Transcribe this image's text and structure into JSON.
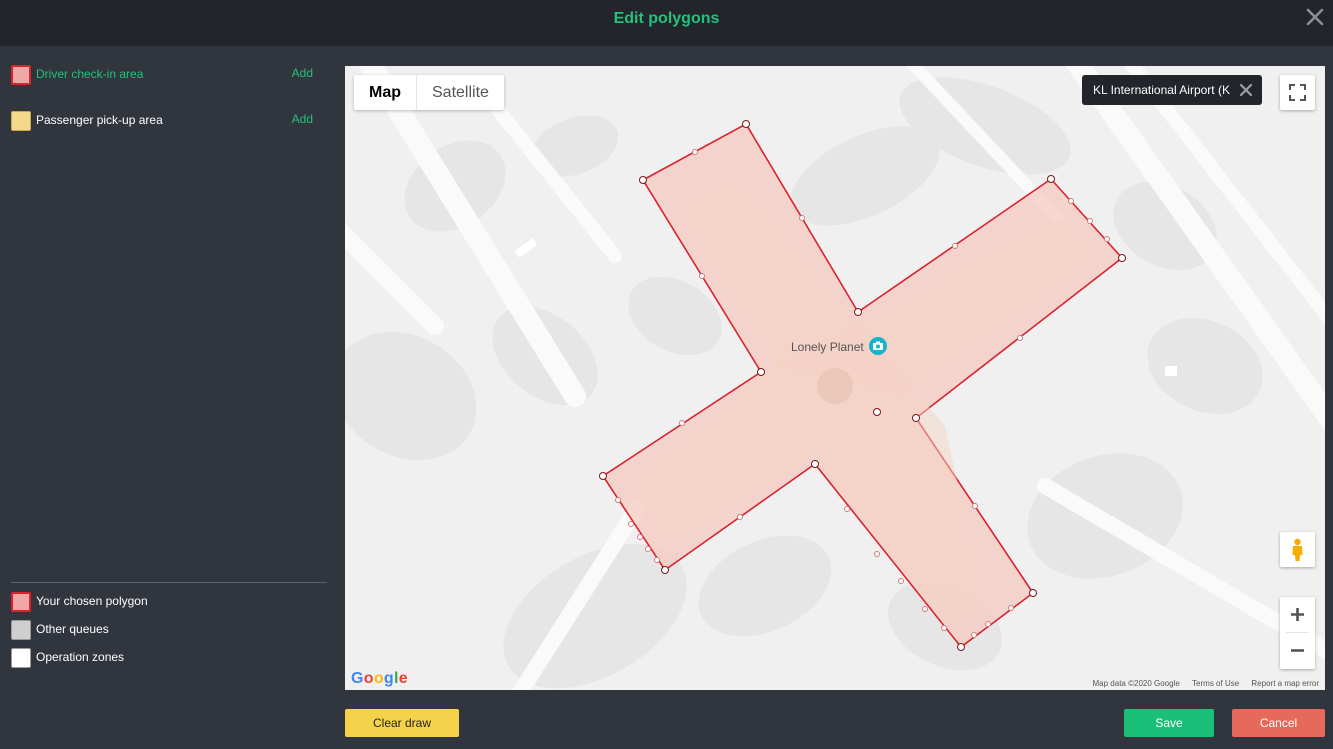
{
  "window": {
    "title": "Edit polygons"
  },
  "areas": [
    {
      "label": "Driver check-in area",
      "add": "Add",
      "color": "#f2a7a7",
      "active": true
    },
    {
      "label": "Passenger pick-up area",
      "add": "Add",
      "color": "#f5d98a",
      "active": false
    }
  ],
  "legend": [
    {
      "label": "Your chosen polygon",
      "color": "#f2a7a7"
    },
    {
      "label": "Other queues",
      "color": "#cfcfcf"
    },
    {
      "label": "Operation zones",
      "color": "#ffffff"
    }
  ],
  "map": {
    "maptype_options": [
      "Map",
      "Satellite"
    ],
    "selected_maptype": "Map",
    "place_chip": "KL International Airport (K",
    "poi_label": "Lonely Planet",
    "google_logo": "Google",
    "attribution": [
      "Map data ©2020 Google",
      "Terms of Use",
      "Report a map error"
    ],
    "polygon_stroke": "#d9232d",
    "polygon_fill": "#f7c9c2"
  },
  "buttons": {
    "clear": "Clear draw",
    "save": "Save",
    "cancel": "Cancel"
  },
  "colors": {
    "accent": "#22c27a",
    "header_bg": "#22252b",
    "panel_bg": "#31353d"
  }
}
